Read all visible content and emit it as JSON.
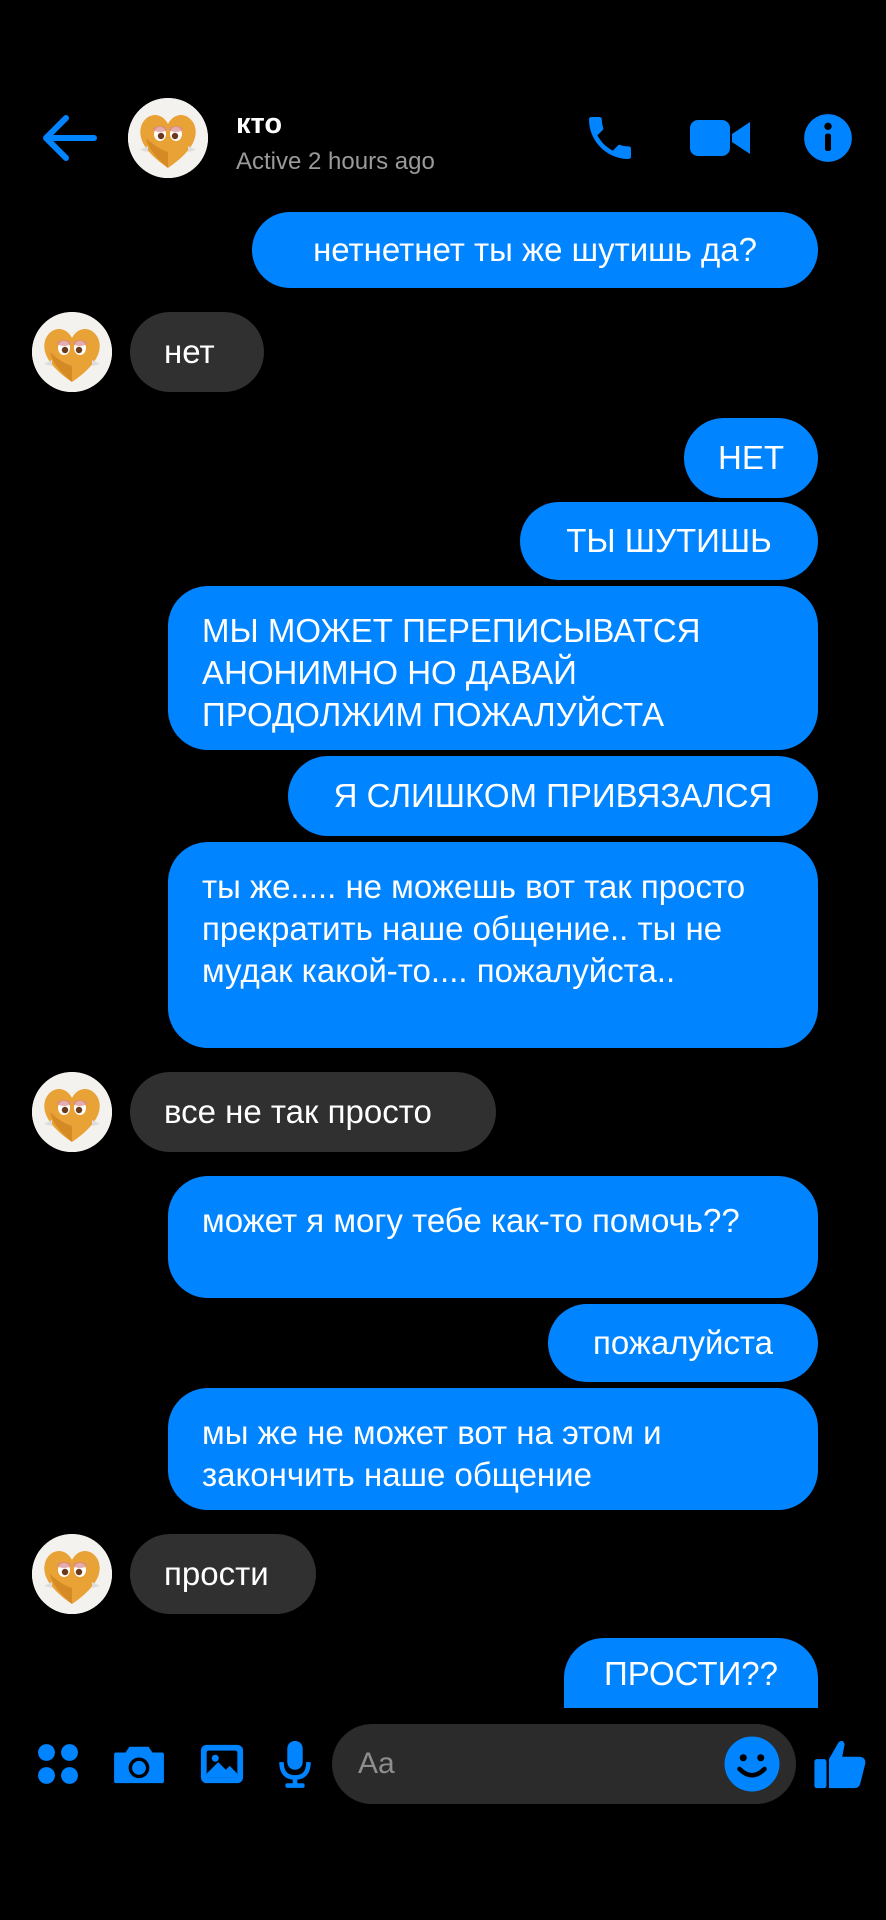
{
  "header": {
    "contact_name": "кто",
    "status": "Active 2 hours ago"
  },
  "colors": {
    "accent": "#0084ff",
    "incoming_bubble": "#303030",
    "background": "#000000"
  },
  "messages": [
    {
      "direction": "outgoing",
      "text": "нетнетнет ты же шутишь да?"
    },
    {
      "direction": "incoming",
      "text": "нет"
    },
    {
      "direction": "outgoing",
      "text": "НЕТ"
    },
    {
      "direction": "outgoing",
      "text": "ТЫ ШУТИШЬ"
    },
    {
      "direction": "outgoing",
      "text": "МЫ МОЖЕТ ПЕРЕПИСЫВАТСЯ АНОНИМНО НО ДАВАЙ ПРОДОЛЖИМ ПОЖАЛУЙСТА"
    },
    {
      "direction": "outgoing",
      "text": "Я СЛИШКОМ ПРИВЯЗАЛСЯ"
    },
    {
      "direction": "outgoing",
      "text": "ты же..... не можешь вот так просто прекратить наше общение.. ты не мудак какой-то.... пожалуйста.."
    },
    {
      "direction": "incoming",
      "text": "все не так просто"
    },
    {
      "direction": "outgoing",
      "text": "может я могу тебе как-то помочь??"
    },
    {
      "direction": "outgoing",
      "text": "пожалуйста"
    },
    {
      "direction": "outgoing",
      "text": "мы же не может вот на этом и закончить наше общение"
    },
    {
      "direction": "incoming",
      "text": "прости"
    },
    {
      "direction": "outgoing",
      "text": "ПРОСТИ??"
    }
  ],
  "composer": {
    "placeholder": "Aa"
  },
  "icons": [
    "back-arrow-icon",
    "phone-icon",
    "video-camera-icon",
    "info-icon",
    "apps-grid-icon",
    "camera-icon",
    "gallery-icon",
    "microphone-icon",
    "emoji-icon",
    "thumbs-up-icon"
  ]
}
